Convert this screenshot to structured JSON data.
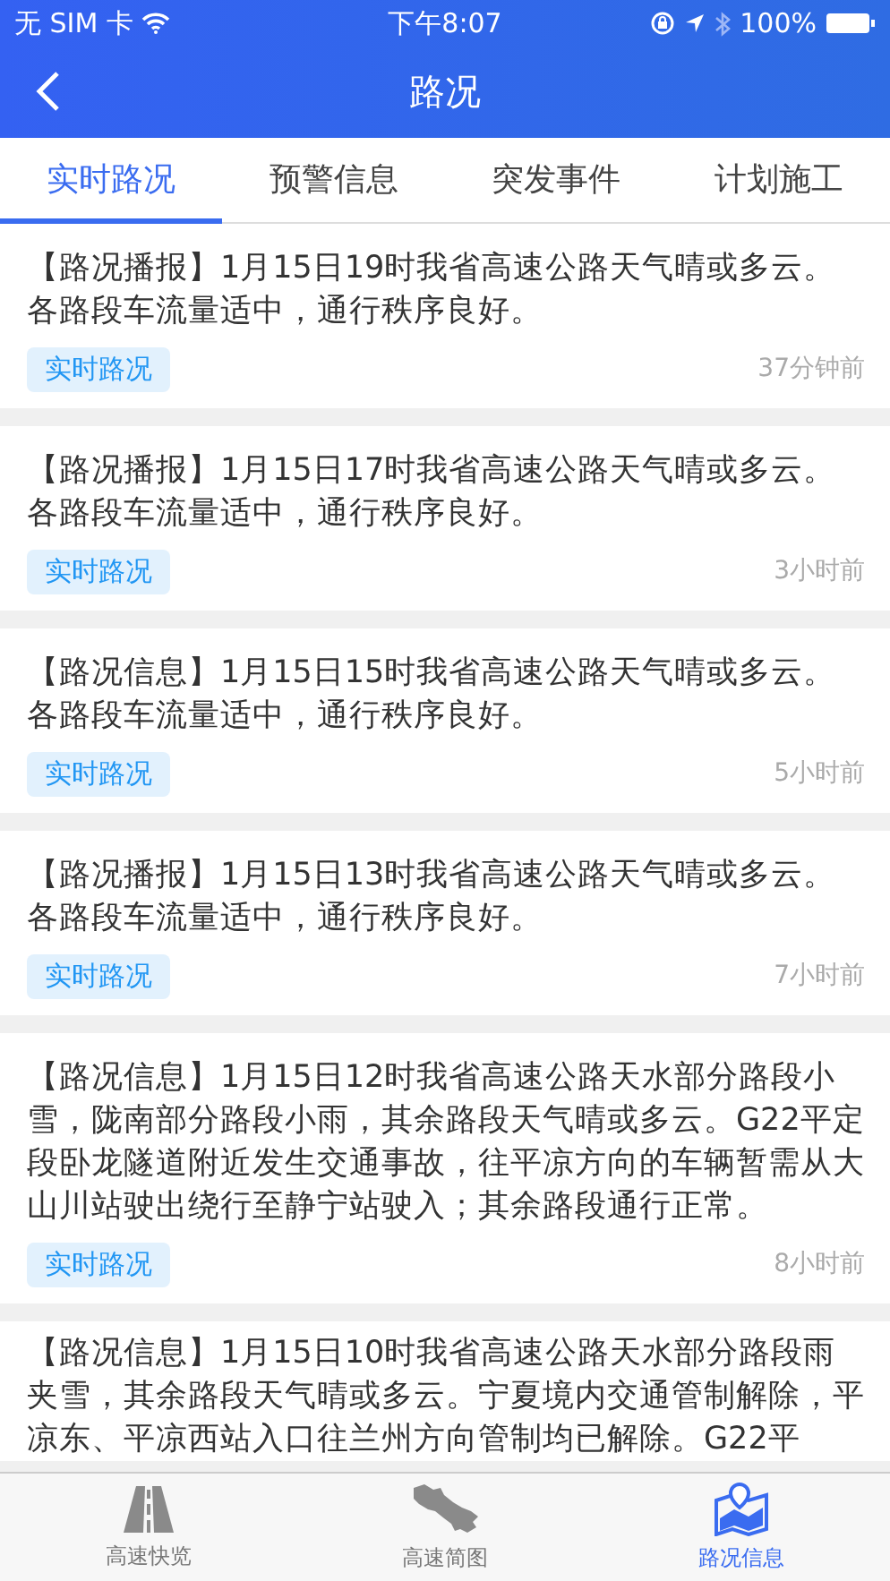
{
  "status_bar": {
    "carrier": "无 SIM 卡",
    "time": "下午8:07",
    "battery": "100%"
  },
  "nav": {
    "title": "路况"
  },
  "tabs": [
    {
      "label": "实时路况",
      "selected": true
    },
    {
      "label": "预警信息",
      "selected": false
    },
    {
      "label": "突发事件",
      "selected": false
    },
    {
      "label": "计划施工",
      "selected": false
    }
  ],
  "items": [
    {
      "text": "【路况播报】1月15日19时我省高速公路天气晴或多云。各路段车流量适中，通行秩序良好。",
      "tag": "实时路况",
      "time": "37分钟前"
    },
    {
      "text": "【路况播报】1月15日17时我省高速公路天气晴或多云。各路段车流量适中，通行秩序良好。",
      "tag": "实时路况",
      "time": "3小时前"
    },
    {
      "text": "【路况信息】1月15日15时我省高速公路天气晴或多云。各路段车流量适中，通行秩序良好。",
      "tag": "实时路况",
      "time": "5小时前"
    },
    {
      "text": "【路况播报】1月15日13时我省高速公路天气晴或多云。各路段车流量适中，通行秩序良好。",
      "tag": "实时路况",
      "time": "7小时前"
    },
    {
      "text": "【路况信息】1月15日12时我省高速公路天水部分路段小雪，陇南部分路段小雨，其余路段天气晴或多云。G22平定段卧龙隧道附近发生交通事故，往平凉方向的车辆暂需从大山川站驶出绕行至静宁站驶入；其余路段通行正常。",
      "tag": "实时路况",
      "time": "8小时前"
    },
    {
      "text": "【路况信息】1月15日10时我省高速公路天水部分路段雨夹雪，其余路段天气晴或多云。宁夏境内交通管制解除，平凉东、平凉西站入口往兰州方向管制均已解除。G22平"
    }
  ],
  "bottom_tabs": [
    {
      "label": "高速快览",
      "selected": false
    },
    {
      "label": "高速简图",
      "selected": false
    },
    {
      "label": "路况信息",
      "selected": true
    }
  ]
}
